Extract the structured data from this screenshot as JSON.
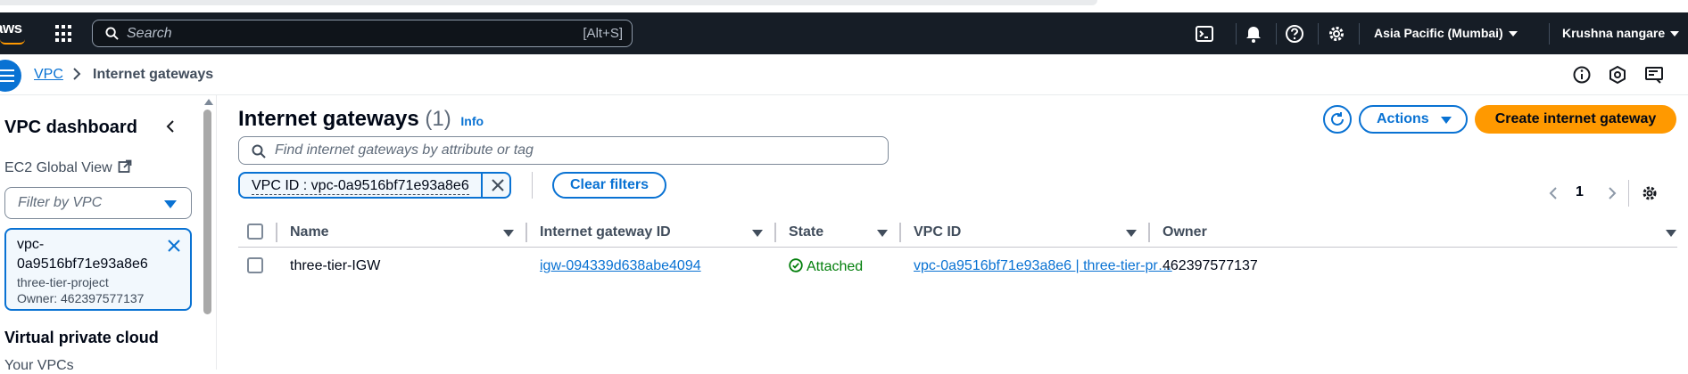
{
  "topnav": {
    "logo": "aws",
    "search_placeholder": "Search",
    "search_shortcut": "[Alt+S]",
    "region": "Asia Pacific (Mumbai)",
    "user": "Krushna nangare"
  },
  "breadcrumb": {
    "service": "VPC",
    "current": "Internet gateways"
  },
  "sidenav": {
    "title": "VPC dashboard",
    "global_view": "EC2 Global View",
    "filter_placeholder": "Filter by VPC",
    "selected_vpc": {
      "id": "vpc-0a9516bf71e93a8e6",
      "name": "three-tier-project",
      "owner": "Owner: 462397577137"
    },
    "section": "Virtual private cloud",
    "items": [
      {
        "label": "Your VPCs"
      }
    ]
  },
  "main": {
    "title": "Internet gateways",
    "count": "(1)",
    "info": "Info",
    "actions_label": "Actions",
    "create_label": "Create internet gateway",
    "find_placeholder": "Find internet gateways by attribute or tag",
    "filter_token": "VPC ID : vpc-0a9516bf71e93a8e6",
    "clear_filters": "Clear filters",
    "page": "1"
  },
  "table": {
    "columns": [
      "Name",
      "Internet gateway ID",
      "State",
      "VPC ID",
      "Owner"
    ],
    "rows": [
      {
        "name": "three-tier-IGW",
        "igw_id": "igw-094339d638abe4094",
        "state": "Attached",
        "vpc_id": "vpc-0a9516bf71e93a8e6 | three-tier-pr…",
        "owner": "462397577137"
      }
    ]
  },
  "colors": {
    "nav_bg": "#161d26",
    "link": "#0972d3",
    "primary": "#ff9900",
    "success": "#037f0c"
  }
}
